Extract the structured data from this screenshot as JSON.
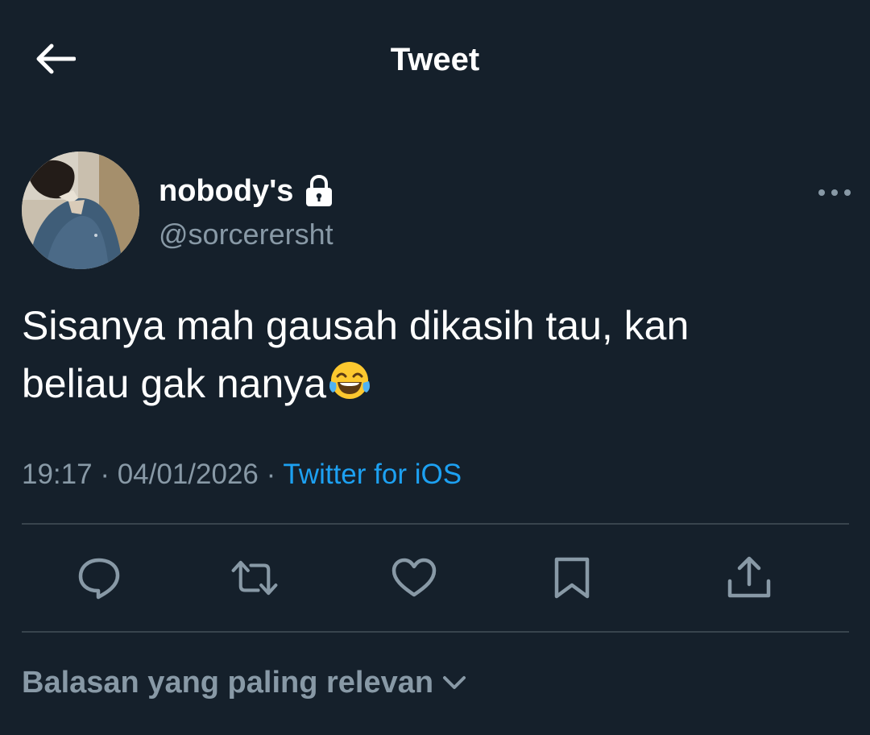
{
  "header": {
    "back_icon": "arrow-left-icon",
    "title": "Tweet"
  },
  "author": {
    "avatar_icon": "avatar-photo",
    "display_name": "nobody's",
    "protected_icon": "lock-icon",
    "handle": "@sorcerersht",
    "more_icon": "more-horizontal-icon"
  },
  "tweet": {
    "text_line1": "Sisanya mah gausah dikasih tau, kan",
    "text_line2": "beliau gak nanya",
    "emoji": "face-with-tears-of-joy",
    "time": "19:17",
    "separator": " · ",
    "date": "04/01/2026",
    "source": "Twitter for iOS"
  },
  "actions": [
    {
      "name": "reply",
      "icon": "reply-icon"
    },
    {
      "name": "retweet",
      "icon": "retweet-icon"
    },
    {
      "name": "like",
      "icon": "heart-icon"
    },
    {
      "name": "bookmark",
      "icon": "bookmark-icon"
    },
    {
      "name": "share",
      "icon": "share-icon"
    }
  ],
  "replies": {
    "sort_label": "Balasan yang paling relevan",
    "sort_icon": "chevron-down-icon"
  },
  "colors": {
    "background": "#15202b",
    "text_primary": "#ffffff",
    "text_secondary": "#8899a6",
    "accent": "#1da1f2",
    "divider": "#38444d"
  }
}
